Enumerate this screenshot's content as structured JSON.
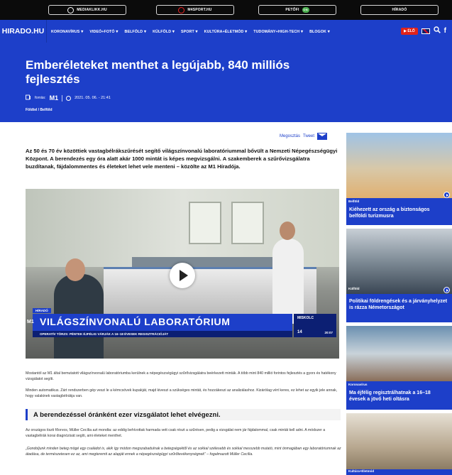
{
  "network": [
    {
      "label": "MEDIAKLIKK.HU",
      "icon": "ring-icon"
    },
    {
      "label": "M4SPORT.HU",
      "icon": "ring-red-icon"
    },
    {
      "label": "PETŐFI",
      "icon": "petofi-badge"
    },
    {
      "label": "HÍRADÓ",
      "icon": "hirado-logo"
    }
  ],
  "petofi_badge": "ON",
  "nav": {
    "logo": "HIRADO.HU",
    "items": [
      "KORONAVÍRUS",
      "VIDEÓ+FOTÓ",
      "BELFÖLD",
      "KÜLFÖLD",
      "SPORT",
      "KULTÚRA+ÉLETMÓD",
      "TUDOMÁNY+HIGH-TECH",
      "BLOGOK"
    ],
    "live": "▶ ÉLŐ",
    "search_icon": "🔍",
    "facebook_icon": "f"
  },
  "hero": {
    "title": "Emberéleteket menthet a legújabb, 840 milliós fejlesztés",
    "source_label": "forrás:",
    "source": "M1",
    "date": "2021. 05. 06. - 21:41",
    "category": "Földtel / Belföld"
  },
  "share": {
    "label": "Megosztás",
    "tweet": "Tweet"
  },
  "article": {
    "lead": "Az 50 és 70 év közöttiek vastagbélrákszűrését segítő világszínvonalú laboratóriummal bővült a Nemzeti Népegészségügyi Központ. A berendezés egy óra alatt akár 1000 mintát is képes megvizsgálni. A szakemberek a szűrővizsgálatra buzdítanak, fájdalommentes és életeket lehet vele menteni – közölte az M1 Híradója.",
    "video": {
      "tag": "HÍRADÓ",
      "title": "VILÁGSZÍNVONALÚ LABORATÓRIUM",
      "subtitle": "OPERATÍV TÖRZS: PÉNTEK ÉJFÉLIG VÁRJÁK A 16–18 ÉVESEK REGISZTRÁCIÓJÁT",
      "channel": "M1",
      "city": "MISKOLC",
      "temp": "14",
      "time": "20:07"
    },
    "p1": "Mostantól az M1 által bemutatott világszínvonalú laboratóriumba kerülnek a népegészségügyi szűrővizsgálatra beérkezett minták. A több mint 840 millió forintos fejlesztés a gyors és hatékony vizsgálatot segíti.",
    "p2": "Minden automatikus. Zárt rendszerben gép veszi le a kémcsövek kupakját, majd kiveszi a szükséges mintát, és hozzákeszi az analizálashoz. Kizárólag vért keres, ez lehet az egyik jele annak, hogy valakinek vastagbélrákja van.",
    "subhead": "A berendezéssel óránként ezer vizsgálatot lehet elvégezni.",
    "p3": "Az országos tiszti főorvos, Müller Cecília azt mondta: az eddig behívottak harmada vett csak részt a szűrésen, pedig a vizsgálat nem jár fájdalommal, csak mintát kell adni. A módszer a vastagbélrák korai diagnózisát segíti, ami életeket menthet.",
    "p4": "„Gondoljunk minden beteg mögé egy családot is, akik így módon megszabadulnak a betegségektől és az sokkal szélesebb és sokkal messzebb mutató, mint önmagában egy laboratóriumnak az átadása, de természetesen ez az, ami megteremti az alapját ennek a népegészségügyi szűrőtevékenységnek” – fogalmazott Müller Cecília."
  },
  "sidebar": [
    {
      "category": "Belföld",
      "title": "Kiéhezett az ország a biztonságos belföldi turizmusra"
    },
    {
      "category": "Külföld",
      "title": "Politikai földrengések és a járványhelyzet is rázza Németországot"
    },
    {
      "category": "Koronavírus",
      "title": "Ma éjfélig regisztrálhatnak a 16–18 évesek a jövő heti oltásra"
    },
    {
      "category": "Kultúra+Életmód",
      "title": ""
    }
  ],
  "colors": {
    "brand": "#1d3fc9",
    "topbar": "#0b0b0b",
    "live": "#e2231a"
  }
}
